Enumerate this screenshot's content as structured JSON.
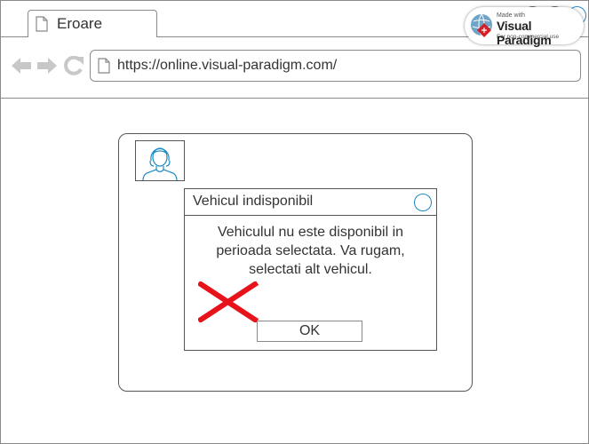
{
  "browser": {
    "tab": {
      "title": "Eroare"
    },
    "url": "https://online.visual-paradigm.com/"
  },
  "dialog": {
    "title": "Vehicul indisponibil",
    "message": "Vehiculul nu este disponibil in perioada selectata. Va rugam, selectati alt vehicul.",
    "ok_label": "OK",
    "icon": "error-x-icon",
    "error_color": "#e8121a"
  },
  "watermark": {
    "made_with": "Made with",
    "brand": "Visual Paradigm",
    "note": "For non-commercial use"
  },
  "colors": {
    "accent": "#1e8bc3",
    "error": "#e8121a"
  }
}
